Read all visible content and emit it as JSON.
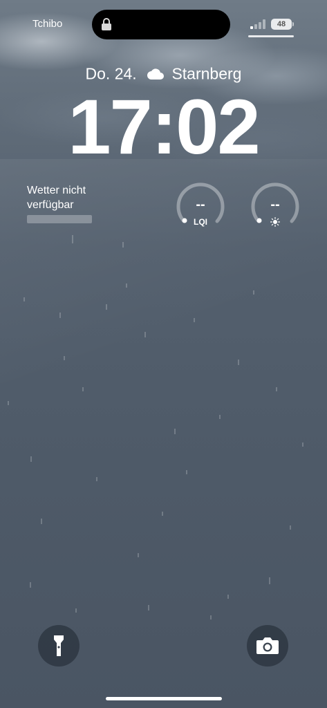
{
  "status_bar": {
    "carrier": "Tchibo",
    "battery": "48",
    "lock_icon": "lock-icon",
    "signal_icon": "cellular-signal-icon"
  },
  "lock_screen": {
    "date": "Do. 24.",
    "weather_icon": "cloud-icon",
    "location": "Starnberg",
    "time": "17:02"
  },
  "widgets": {
    "weather": {
      "text_line1": "Wetter nicht",
      "text_line2": "verfügbar"
    },
    "gauges": [
      {
        "value": "--",
        "label": "LQI"
      },
      {
        "value": "--",
        "label_icon": "sun-icon"
      }
    ]
  },
  "quick_actions": {
    "left_icon": "flashlight-icon",
    "right_icon": "camera-icon"
  }
}
